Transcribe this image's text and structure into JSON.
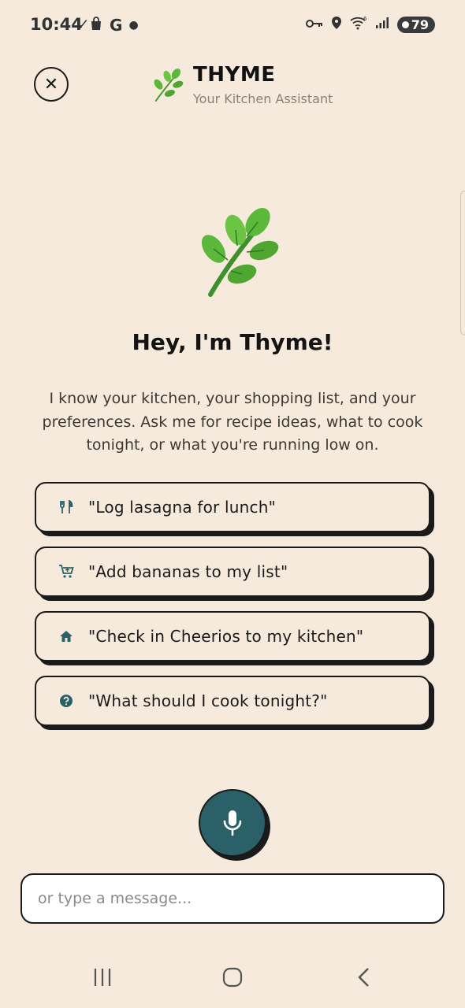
{
  "status_bar": {
    "time": "10:44",
    "battery": "79",
    "left_icons": [
      "data-saver-icon",
      "shopping-bag-icon",
      "google-icon",
      "dot-icon"
    ],
    "right_icons": [
      "vpn-key-icon",
      "location-icon",
      "wifi-6-icon",
      "signal-icon",
      "battery-icon"
    ]
  },
  "header": {
    "title": "THYME",
    "subtitle": "Your Kitchen Assistant",
    "close_icon": "close-icon",
    "logo_icon": "herb-icon"
  },
  "hero": {
    "icon": "herb-icon",
    "title": "Hey, I'm Thyme!",
    "description": "I know your kitchen, your shopping list, and your preferences. Ask me for recipe ideas, what to cook tonight, or what you're running low on."
  },
  "suggestions": [
    {
      "icon": "utensils-icon",
      "label": "\"Log lasagna for lunch\""
    },
    {
      "icon": "cart-add-icon",
      "label": "\"Add bananas to my list\""
    },
    {
      "icon": "home-icon",
      "label": "\"Check in Cheerios to my kitchen\""
    },
    {
      "icon": "help-circle-icon",
      "label": "\"What should I cook tonight?\""
    }
  ],
  "mic": {
    "icon": "microphone-icon"
  },
  "input": {
    "placeholder": "or type a message...",
    "value": ""
  },
  "nav_bar": {
    "icons": [
      "recent-apps-icon",
      "home-button-icon",
      "back-icon"
    ]
  },
  "colors": {
    "background": "#f5eadb",
    "accent": "#2b6068",
    "border": "#1a1a1a",
    "muted_text": "#8a8074"
  }
}
